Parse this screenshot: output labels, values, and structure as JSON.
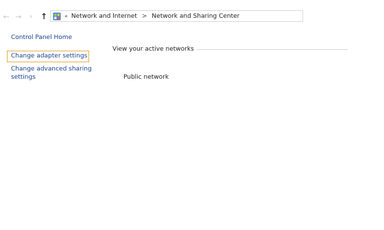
{
  "navigation": {
    "back_icon": "back-arrow-icon",
    "forward_icon": "forward-arrow-icon",
    "recent_icon": "chevron-down-icon",
    "up_icon": "up-arrow-icon"
  },
  "address_bar": {
    "icon": "control-panel-icon",
    "overflow": "«",
    "breadcrumbs": [
      "Network and Internet",
      "Network and Sharing Center"
    ],
    "separator": ">"
  },
  "sidebar": {
    "items": [
      {
        "label": "Control Panel Home"
      },
      {
        "label": "Change adapter settings",
        "highlighted": true
      },
      {
        "label": "Change advanced sharing settings"
      }
    ],
    "highlight_color": "#e8b04a",
    "link_color": "#1a3f8f"
  },
  "main": {
    "section_title": "View your active networks",
    "network_name": "Public network"
  }
}
